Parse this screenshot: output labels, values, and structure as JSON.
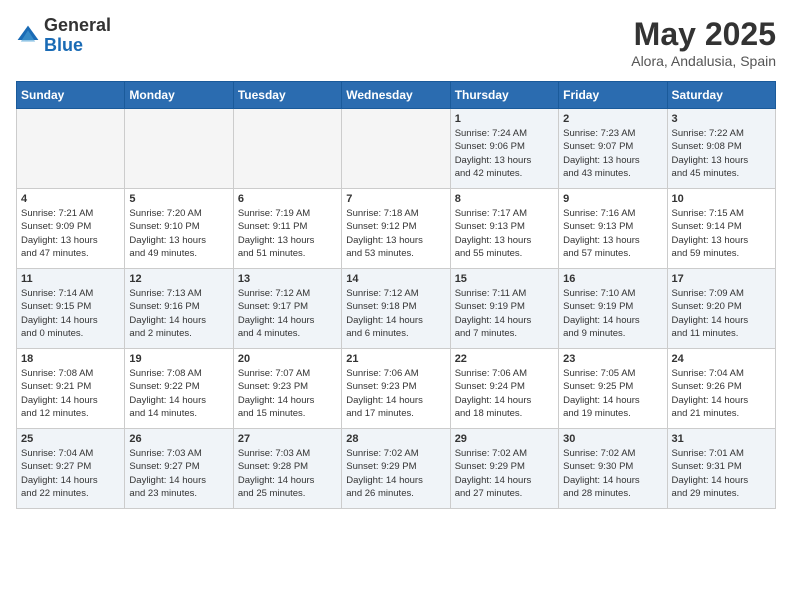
{
  "header": {
    "logo_general": "General",
    "logo_blue": "Blue",
    "month_year": "May 2025",
    "location": "Alora, Andalusia, Spain"
  },
  "weekdays": [
    "Sunday",
    "Monday",
    "Tuesday",
    "Wednesday",
    "Thursday",
    "Friday",
    "Saturday"
  ],
  "weeks": [
    [
      {
        "day": "",
        "info": ""
      },
      {
        "day": "",
        "info": ""
      },
      {
        "day": "",
        "info": ""
      },
      {
        "day": "",
        "info": ""
      },
      {
        "day": "1",
        "info": "Sunrise: 7:24 AM\nSunset: 9:06 PM\nDaylight: 13 hours\nand 42 minutes."
      },
      {
        "day": "2",
        "info": "Sunrise: 7:23 AM\nSunset: 9:07 PM\nDaylight: 13 hours\nand 43 minutes."
      },
      {
        "day": "3",
        "info": "Sunrise: 7:22 AM\nSunset: 9:08 PM\nDaylight: 13 hours\nand 45 minutes."
      }
    ],
    [
      {
        "day": "4",
        "info": "Sunrise: 7:21 AM\nSunset: 9:09 PM\nDaylight: 13 hours\nand 47 minutes."
      },
      {
        "day": "5",
        "info": "Sunrise: 7:20 AM\nSunset: 9:10 PM\nDaylight: 13 hours\nand 49 minutes."
      },
      {
        "day": "6",
        "info": "Sunrise: 7:19 AM\nSunset: 9:11 PM\nDaylight: 13 hours\nand 51 minutes."
      },
      {
        "day": "7",
        "info": "Sunrise: 7:18 AM\nSunset: 9:12 PM\nDaylight: 13 hours\nand 53 minutes."
      },
      {
        "day": "8",
        "info": "Sunrise: 7:17 AM\nSunset: 9:13 PM\nDaylight: 13 hours\nand 55 minutes."
      },
      {
        "day": "9",
        "info": "Sunrise: 7:16 AM\nSunset: 9:13 PM\nDaylight: 13 hours\nand 57 minutes."
      },
      {
        "day": "10",
        "info": "Sunrise: 7:15 AM\nSunset: 9:14 PM\nDaylight: 13 hours\nand 59 minutes."
      }
    ],
    [
      {
        "day": "11",
        "info": "Sunrise: 7:14 AM\nSunset: 9:15 PM\nDaylight: 14 hours\nand 0 minutes."
      },
      {
        "day": "12",
        "info": "Sunrise: 7:13 AM\nSunset: 9:16 PM\nDaylight: 14 hours\nand 2 minutes."
      },
      {
        "day": "13",
        "info": "Sunrise: 7:12 AM\nSunset: 9:17 PM\nDaylight: 14 hours\nand 4 minutes."
      },
      {
        "day": "14",
        "info": "Sunrise: 7:12 AM\nSunset: 9:18 PM\nDaylight: 14 hours\nand 6 minutes."
      },
      {
        "day": "15",
        "info": "Sunrise: 7:11 AM\nSunset: 9:19 PM\nDaylight: 14 hours\nand 7 minutes."
      },
      {
        "day": "16",
        "info": "Sunrise: 7:10 AM\nSunset: 9:19 PM\nDaylight: 14 hours\nand 9 minutes."
      },
      {
        "day": "17",
        "info": "Sunrise: 7:09 AM\nSunset: 9:20 PM\nDaylight: 14 hours\nand 11 minutes."
      }
    ],
    [
      {
        "day": "18",
        "info": "Sunrise: 7:08 AM\nSunset: 9:21 PM\nDaylight: 14 hours\nand 12 minutes."
      },
      {
        "day": "19",
        "info": "Sunrise: 7:08 AM\nSunset: 9:22 PM\nDaylight: 14 hours\nand 14 minutes."
      },
      {
        "day": "20",
        "info": "Sunrise: 7:07 AM\nSunset: 9:23 PM\nDaylight: 14 hours\nand 15 minutes."
      },
      {
        "day": "21",
        "info": "Sunrise: 7:06 AM\nSunset: 9:23 PM\nDaylight: 14 hours\nand 17 minutes."
      },
      {
        "day": "22",
        "info": "Sunrise: 7:06 AM\nSunset: 9:24 PM\nDaylight: 14 hours\nand 18 minutes."
      },
      {
        "day": "23",
        "info": "Sunrise: 7:05 AM\nSunset: 9:25 PM\nDaylight: 14 hours\nand 19 minutes."
      },
      {
        "day": "24",
        "info": "Sunrise: 7:04 AM\nSunset: 9:26 PM\nDaylight: 14 hours\nand 21 minutes."
      }
    ],
    [
      {
        "day": "25",
        "info": "Sunrise: 7:04 AM\nSunset: 9:27 PM\nDaylight: 14 hours\nand 22 minutes."
      },
      {
        "day": "26",
        "info": "Sunrise: 7:03 AM\nSunset: 9:27 PM\nDaylight: 14 hours\nand 23 minutes."
      },
      {
        "day": "27",
        "info": "Sunrise: 7:03 AM\nSunset: 9:28 PM\nDaylight: 14 hours\nand 25 minutes."
      },
      {
        "day": "28",
        "info": "Sunrise: 7:02 AM\nSunset: 9:29 PM\nDaylight: 14 hours\nand 26 minutes."
      },
      {
        "day": "29",
        "info": "Sunrise: 7:02 AM\nSunset: 9:29 PM\nDaylight: 14 hours\nand 27 minutes."
      },
      {
        "day": "30",
        "info": "Sunrise: 7:02 AM\nSunset: 9:30 PM\nDaylight: 14 hours\nand 28 minutes."
      },
      {
        "day": "31",
        "info": "Sunrise: 7:01 AM\nSunset: 9:31 PM\nDaylight: 14 hours\nand 29 minutes."
      }
    ]
  ]
}
